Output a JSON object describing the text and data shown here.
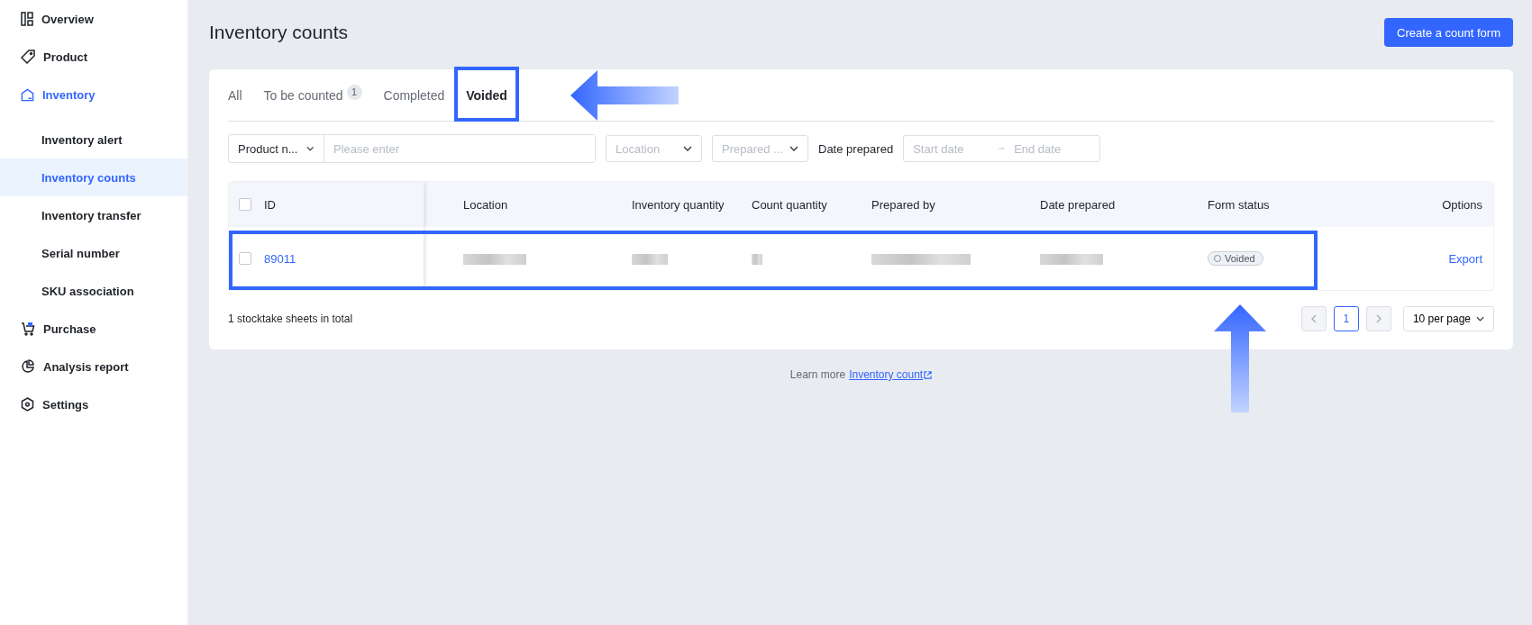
{
  "sidebar": {
    "items": [
      {
        "label": "Overview",
        "selected": false
      },
      {
        "label": "Product",
        "selected": false
      },
      {
        "label": "Inventory",
        "selected": true,
        "children": [
          {
            "label": "Inventory alert",
            "selected": false
          },
          {
            "label": "Inventory counts",
            "selected": true
          },
          {
            "label": "Inventory transfer",
            "selected": false
          },
          {
            "label": "Serial number",
            "selected": false
          },
          {
            "label": "SKU association",
            "selected": false
          }
        ]
      },
      {
        "label": "Purchase",
        "selected": false
      },
      {
        "label": "Analysis report",
        "selected": false
      },
      {
        "label": "Settings",
        "selected": false
      }
    ]
  },
  "page": {
    "title": "Inventory counts",
    "primary_button": "Create a count form"
  },
  "tabs": [
    {
      "label": "All",
      "selected": false,
      "highlighted": false
    },
    {
      "label": "To be counted",
      "badge": "1",
      "selected": false,
      "highlighted": false
    },
    {
      "label": "Completed",
      "selected": false,
      "highlighted": false
    },
    {
      "label": "Voided",
      "selected": true,
      "highlighted": true,
      "arrow": true
    }
  ],
  "filters": {
    "product_select": "Product n...",
    "search": {
      "placeholder": "Please enter"
    },
    "location": {
      "placeholder": "Location"
    },
    "prepared_by": {
      "placeholder": "Prepared ..."
    },
    "date_label": "Date prepared",
    "start_date": {
      "placeholder": "Start date"
    },
    "end_date": {
      "placeholder": "End date"
    }
  },
  "table": {
    "columns": [
      "ID",
      "Location",
      "Inventory quantity",
      "Count quantity",
      "Prepared by",
      "Date prepared",
      "Form status",
      "Options"
    ],
    "header_checked": false,
    "rows": [
      {
        "checked": false,
        "highlighted": true,
        "arrow": true,
        "id": "89011",
        "cells": [
          {
            "kind": "redacted"
          },
          {
            "kind": "redacted"
          },
          {
            "kind": "redacted"
          },
          {
            "kind": "redacted"
          },
          {
            "kind": "redacted"
          }
        ],
        "status": {
          "text": "Voided",
          "kind": "voided"
        },
        "action": "Export"
      }
    ]
  },
  "footer": {
    "total": "1 stocktake sheets in total",
    "pages": [
      {
        "label": "1",
        "selected": true
      }
    ],
    "page_size": "10 per page"
  },
  "help": {
    "text": "Learn more",
    "link": "Inventory count"
  }
}
